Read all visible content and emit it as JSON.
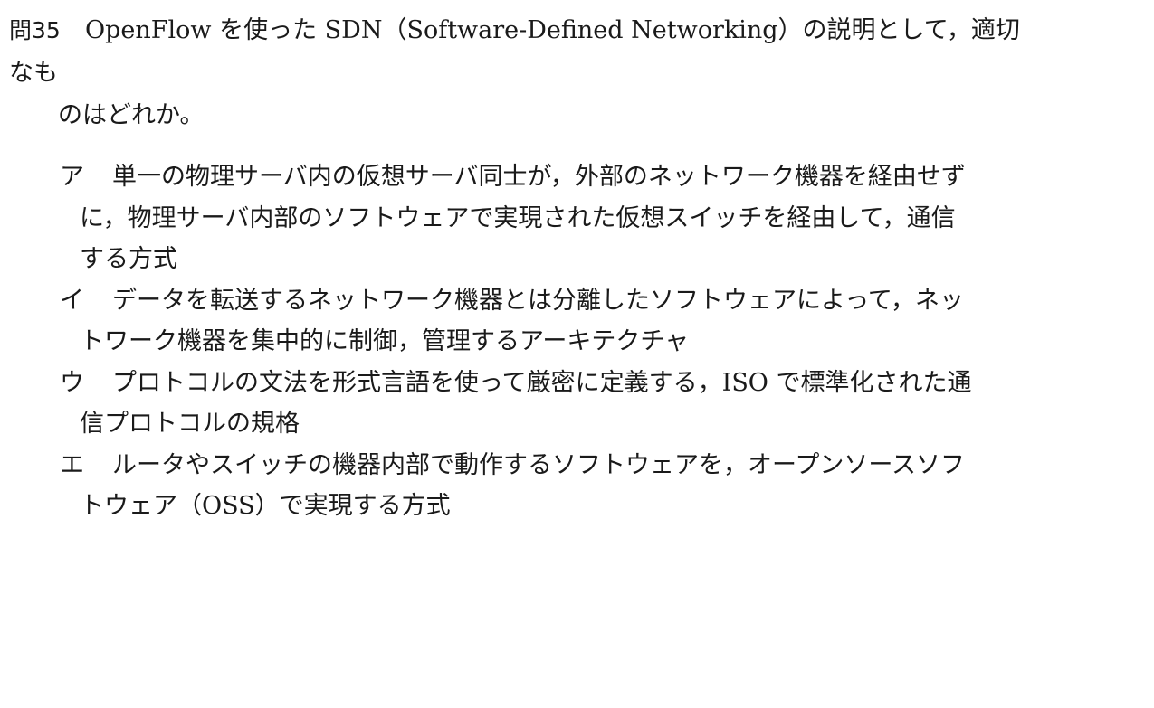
{
  "question": {
    "number": "問35",
    "line1": "OpenFlow を使った SDN（Software-Defined Networking）の説明として，適切なも",
    "line2": "のはどれか。"
  },
  "choices": [
    {
      "label": "ア",
      "lines": [
        "単一の物理サーバ内の仮想サーバ同士が，外部のネットワーク機器を経由せず",
        "に，物理サーバ内部のソフトウェアで実現された仮想スイッチを経由して，通信",
        "する方式"
      ]
    },
    {
      "label": "イ",
      "lines": [
        "データを転送するネットワーク機器とは分離したソフトウェアによって，ネッ",
        "トワーク機器を集中的に制御，管理するアーキテクチャ"
      ]
    },
    {
      "label": "ウ",
      "lines": [
        "プロトコルの文法を形式言語を使って厳密に定義する，ISO で標準化された通",
        "信プロトコルの規格"
      ]
    },
    {
      "label": "エ",
      "lines": [
        "ルータやスイッチの機器内部で動作するソフトウェアを，オープンソースソフ",
        "トウェア（OSS）で実現する方式"
      ]
    }
  ]
}
